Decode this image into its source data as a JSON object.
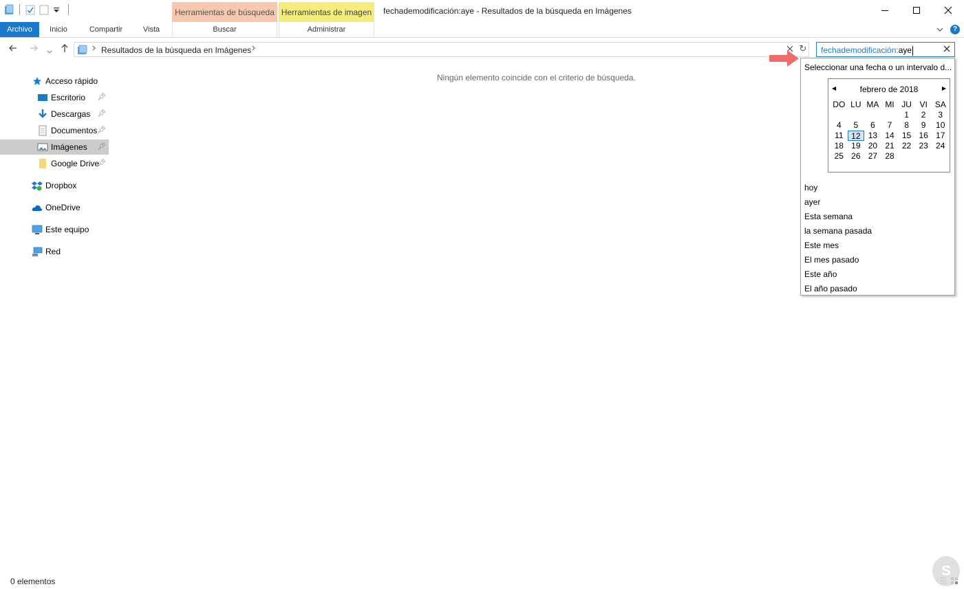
{
  "window": {
    "title": "fechademodificación:aye - Resultados de la búsqueda en Imágenes",
    "context_search": "Herramientas de búsqueda",
    "context_image": "Herramientas de imagen"
  },
  "ribbon": {
    "file": "Archivo",
    "tabs": [
      "Inicio",
      "Compartir",
      "Vista"
    ],
    "search_tab": "Buscar",
    "manage_tab": "Administrar"
  },
  "address": {
    "path": "Resultados de la búsqueda en Imágenes"
  },
  "search": {
    "keyword": "fechademodificación:",
    "value": "aye"
  },
  "nav": {
    "quick_access": "Acceso rápido",
    "items": [
      "Escritorio",
      "Descargas",
      "Documentos",
      "Imágenes",
      "Google Drive"
    ],
    "dropbox": "Dropbox",
    "onedrive": "OneDrive",
    "pc": "Este equipo",
    "network": "Red"
  },
  "main": {
    "empty_message": "Ningún elemento coincide con el criterio de búsqueda."
  },
  "dropdown": {
    "header": "Seleccionar una fecha o un intervalo d...",
    "calendar": {
      "month": "febrero de 2018",
      "weekdays": [
        "DO",
        "LU",
        "MA",
        "MI",
        "JU",
        "VI",
        "SA"
      ],
      "days": [
        "",
        "",
        "",
        "",
        "1",
        "2",
        "3",
        "4",
        "5",
        "6",
        "7",
        "8",
        "9",
        "10",
        "11",
        "12",
        "13",
        "14",
        "15",
        "16",
        "17",
        "18",
        "19",
        "20",
        "21",
        "22",
        "23",
        "24",
        "25",
        "26",
        "27",
        "28",
        "",
        "",
        ""
      ],
      "today": "12"
    },
    "options": [
      "hoy",
      "ayer",
      "Esta semana",
      "la semana pasada",
      "Este mes",
      "El mes pasado",
      "Este año",
      "El año pasado"
    ]
  },
  "status": {
    "count": "0 elementos"
  },
  "colors": {
    "accent": "#1979ca",
    "search_ctx": "#f6c8b0",
    "image_ctx": "#f4ed7d",
    "selected": "#cccccc",
    "annotation": "#f26b6b"
  }
}
